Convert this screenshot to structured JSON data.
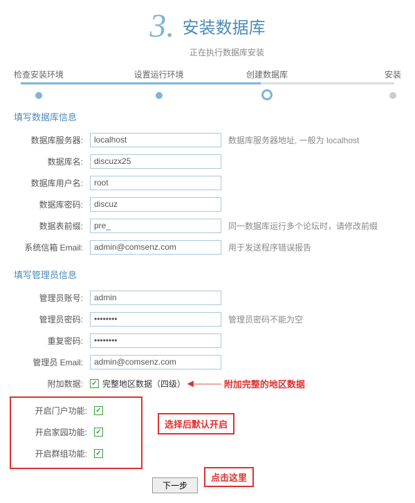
{
  "header": {
    "step_number": "3.",
    "title": "安装数据库",
    "subtitle": "正在执行数据库安装"
  },
  "progress": {
    "steps": [
      "检查安装环境",
      "设置运行环境",
      "创建数据库",
      "安装"
    ]
  },
  "db_section": {
    "heading": "填写数据库信息",
    "rows": [
      {
        "label": "数据库服务器:",
        "value": "localhost",
        "hint": "数据库服务器地址, 一般为 localhost"
      },
      {
        "label": "数据库名:",
        "value": "discuzx25",
        "hint": ""
      },
      {
        "label": "数据库用户名:",
        "value": "root",
        "hint": ""
      },
      {
        "label": "数据库密码:",
        "value": "discuz",
        "hint": ""
      },
      {
        "label": "数据表前缀:",
        "value": "pre_",
        "hint": "同一数据库运行多个论坛时，请修改前缀"
      },
      {
        "label": "系统信箱 Email:",
        "value": "admin@comsenz.com",
        "hint": "用于发送程序错误报告"
      }
    ]
  },
  "admin_section": {
    "heading": "填写管理员信息",
    "rows": [
      {
        "label": "管理员账号:",
        "value": "admin",
        "type": "text",
        "hint": ""
      },
      {
        "label": "管理员密码:",
        "value": "••••••••",
        "type": "password",
        "hint": "管理员密码不能为空"
      },
      {
        "label": "重复密码:",
        "value": "••••••••",
        "type": "password",
        "hint": ""
      },
      {
        "label": "管理员 Email:",
        "value": "admin@comsenz.com",
        "type": "text",
        "hint": ""
      }
    ]
  },
  "extra": {
    "label": "附加数据:",
    "chk_label": "完整地区数据（四级）",
    "arrow_text": "附加完整的地区数据"
  },
  "features": {
    "rows": [
      {
        "label": "开启门户功能:"
      },
      {
        "label": "开启家园功能:"
      },
      {
        "label": "开启群组功能:"
      }
    ],
    "annot": "选择后默认开启"
  },
  "submit": {
    "label": "下一步",
    "annot": "点击这里"
  }
}
